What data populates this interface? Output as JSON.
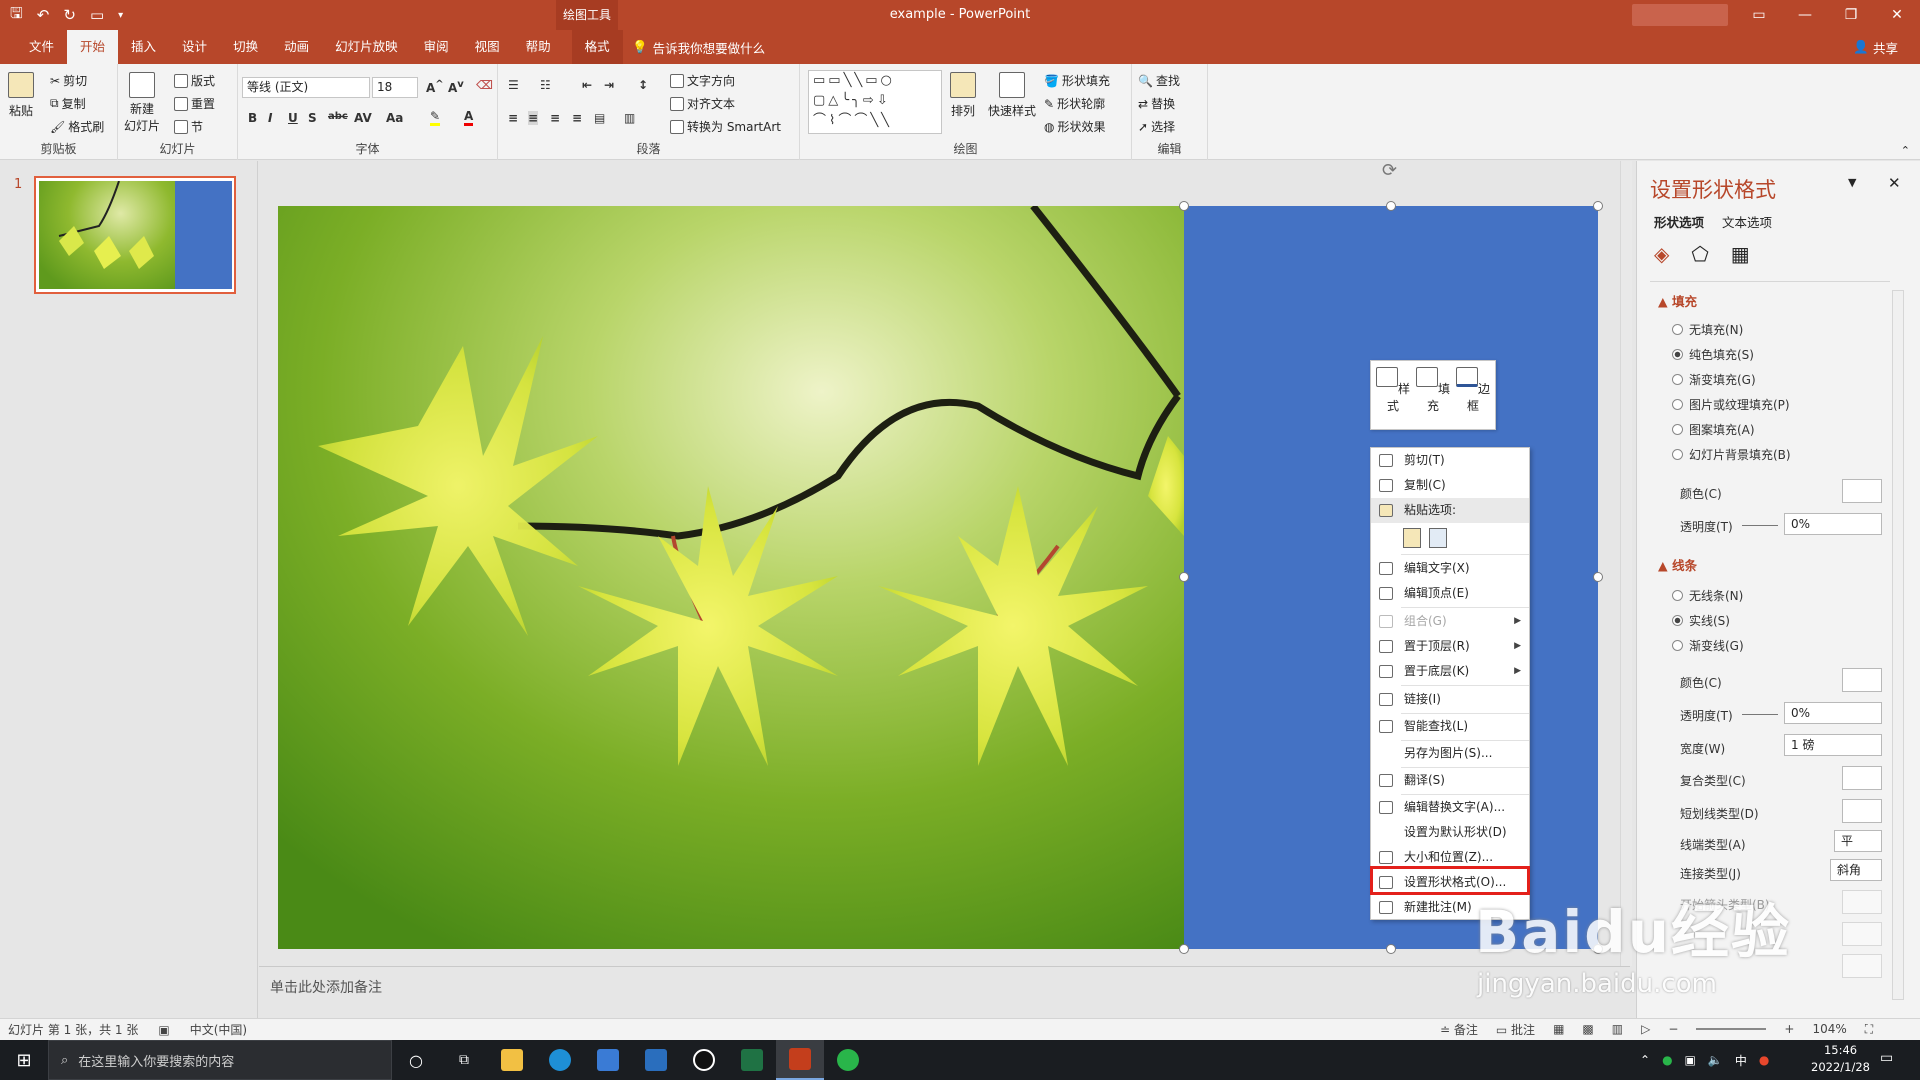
{
  "titlebar": {
    "title": "example  -  PowerPoint",
    "context_tool": "绘图工具",
    "colors": {
      "accent": "#b7472a",
      "selection_rect": "#4472c4",
      "highlight": "#e3201b"
    }
  },
  "tabs": [
    "文件",
    "开始",
    "插入",
    "设计",
    "切换",
    "动画",
    "幻灯片放映",
    "审阅",
    "视图",
    "帮助",
    "格式"
  ],
  "tell_me": "告诉我你想要做什么",
  "share": "共享",
  "ribbon": {
    "clipboard": {
      "label": "剪贴板",
      "paste": "粘贴",
      "cut": "剪切",
      "copy": "复制",
      "painter": "格式刷"
    },
    "slides": {
      "label": "幻灯片",
      "new_slide": "新建\n幻灯片",
      "layout": "版式",
      "reset": "重置",
      "section": "节"
    },
    "font": {
      "label": "字体",
      "font_name": "等线 (正文)",
      "font_size": "18"
    },
    "paragraph": {
      "label": "段落",
      "text_direction": "文字方向",
      "align_text": "对齐文本",
      "smartart": "转换为 SmartArt"
    },
    "drawing": {
      "label": "绘图",
      "arrange": "排列",
      "quick_styles": "快速样式",
      "shape_fill": "形状填充",
      "shape_outline": "形状轮廓",
      "shape_effects": "形状效果"
    },
    "editing": {
      "label": "编辑",
      "find": "查找",
      "replace": "替换",
      "select": "选择"
    }
  },
  "thumbnails": {
    "slide_number": "1"
  },
  "notes_placeholder": "单击此处添加备注",
  "mini_toolbar": {
    "style": "样式",
    "fill": "填充",
    "border": "边框"
  },
  "context_menu": {
    "cut": "剪切(T)",
    "copy": "复制(C)",
    "paste_options": "粘贴选项:",
    "edit_text": "编辑文字(X)",
    "edit_points": "编辑顶点(E)",
    "group": "组合(G)",
    "bring_front": "置于顶层(R)",
    "send_back": "置于底层(K)",
    "link": "链接(I)",
    "smart_lookup": "智能查找(L)",
    "save_as_picture": "另存为图片(S)...",
    "translate": "翻译(S)",
    "edit_alt_text": "编辑替换文字(A)...",
    "set_default": "设置为默认形状(D)",
    "size_position": "大小和位置(Z)...",
    "format_shape": "设置形状格式(O)...",
    "new_comment": "新建批注(M)"
  },
  "format_pane": {
    "title": "设置形状格式",
    "tab_shape": "形状选项",
    "tab_text": "文本选项",
    "fill_section": "填充",
    "fill_options": [
      "无填充(N)",
      "纯色填充(S)",
      "渐变填充(G)",
      "图片或纹理填充(P)",
      "图案填充(A)",
      "幻灯片背景填充(B)"
    ],
    "fill_selected_index": 1,
    "fill_color_label": "颜色(C)",
    "fill_transparency_label": "透明度(T)",
    "fill_transparency": "0%",
    "line_section": "线条",
    "line_options": [
      "无线条(N)",
      "实线(S)",
      "渐变线(G)"
    ],
    "line_selected_index": 1,
    "line_color_label": "颜色(C)",
    "line_transparency_label": "透明度(T)",
    "line_transparency": "0%",
    "width_label": "宽度(W)",
    "width_value": "1 磅",
    "compound_label": "复合类型(C)",
    "dash_label": "短划线类型(D)",
    "cap_label": "线端类型(A)",
    "cap_value": "平",
    "join_label": "连接类型(J)",
    "join_value": "斜角",
    "begin_arrow_label": "开始箭头类型(B)"
  },
  "statusbar": {
    "slide_info": "幻灯片 第 1 张，共 1 张",
    "language": "中文(中国)",
    "notes": "备注",
    "comments": "批注",
    "zoom": "104%"
  },
  "taskbar": {
    "search_placeholder": "在这里输入你要搜索的内容",
    "time": "15:46",
    "date": "2022/1/28",
    "ime": "中"
  },
  "watermark": {
    "brand": "Baidu经验",
    "url": "jingyan.baidu.com"
  }
}
